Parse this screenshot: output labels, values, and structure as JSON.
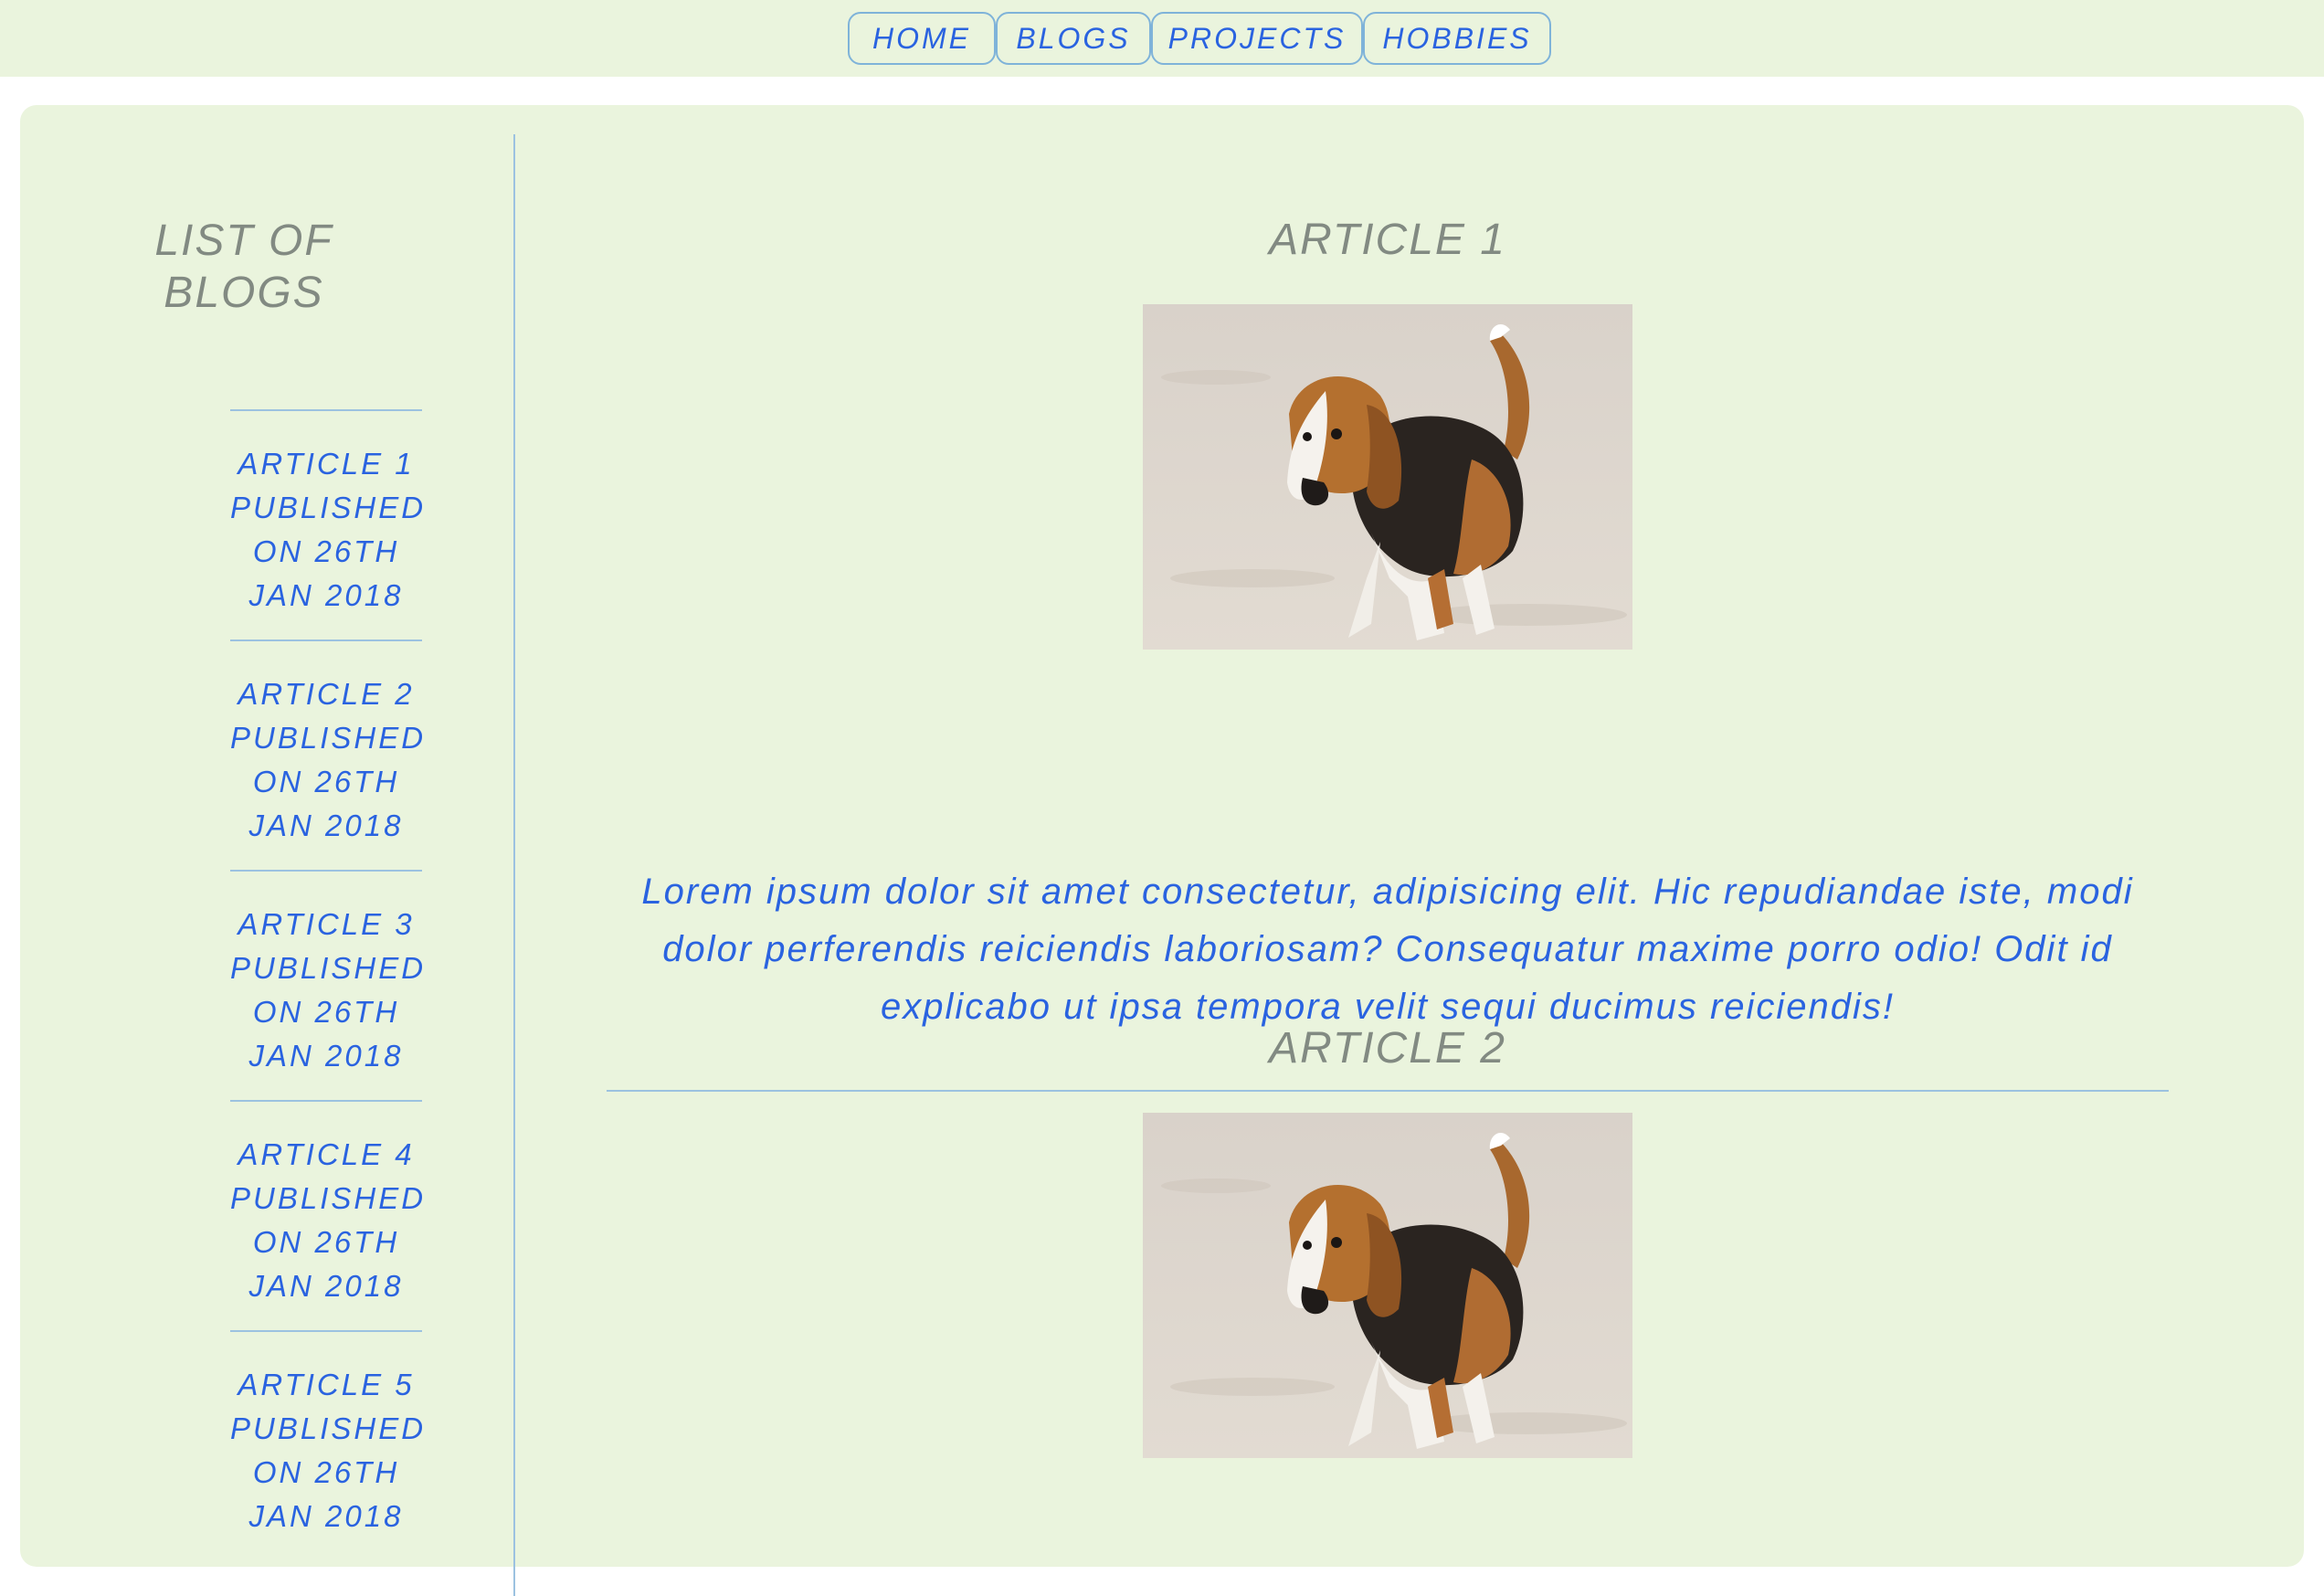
{
  "nav": {
    "items": [
      {
        "label": "HOME"
      },
      {
        "label": "BLOGS"
      },
      {
        "label": "PROJECTS"
      },
      {
        "label": "HOBBIES"
      }
    ]
  },
  "sidebar": {
    "title_line1": "LIST OF",
    "title_line2": "BLOGS",
    "items": [
      {
        "line1": "ARTICLE 1",
        "line2": "PUBLISHED",
        "line3": "ON 26TH",
        "line4": "JAN 2018"
      },
      {
        "line1": "ARTICLE 2",
        "line2": "PUBLISHED",
        "line3": "ON 26TH",
        "line4": "JAN 2018"
      },
      {
        "line1": "ARTICLE 3",
        "line2": "PUBLISHED",
        "line3": "ON 26TH",
        "line4": "JAN 2018"
      },
      {
        "line1": "ARTICLE 4",
        "line2": "PUBLISHED",
        "line3": "ON 26TH",
        "line4": "JAN 2018"
      },
      {
        "line1": "ARTICLE 5",
        "line2": "PUBLISHED",
        "line3": "ON 26TH",
        "line4": "JAN 2018"
      }
    ]
  },
  "articles": [
    {
      "title": "ARTICLE 1",
      "image": "beagle-dog-photo",
      "text": "Lorem ipsum dolor sit amet consectetur, adipisicing elit. Hic repudiandae iste, modi dolor perferendis reiciendis laboriosam? Consequatur maxime porro odio! Odit id explicabo ut ipsa tempora velit sequi ducimus reiciendis!"
    },
    {
      "title": "ARTICLE 2",
      "image": "beagle-dog-photo"
    }
  ],
  "colors": {
    "background": "#eaf4dd",
    "link": "#2a63e0",
    "heading": "#828a82",
    "border": "#9cc2e0"
  }
}
